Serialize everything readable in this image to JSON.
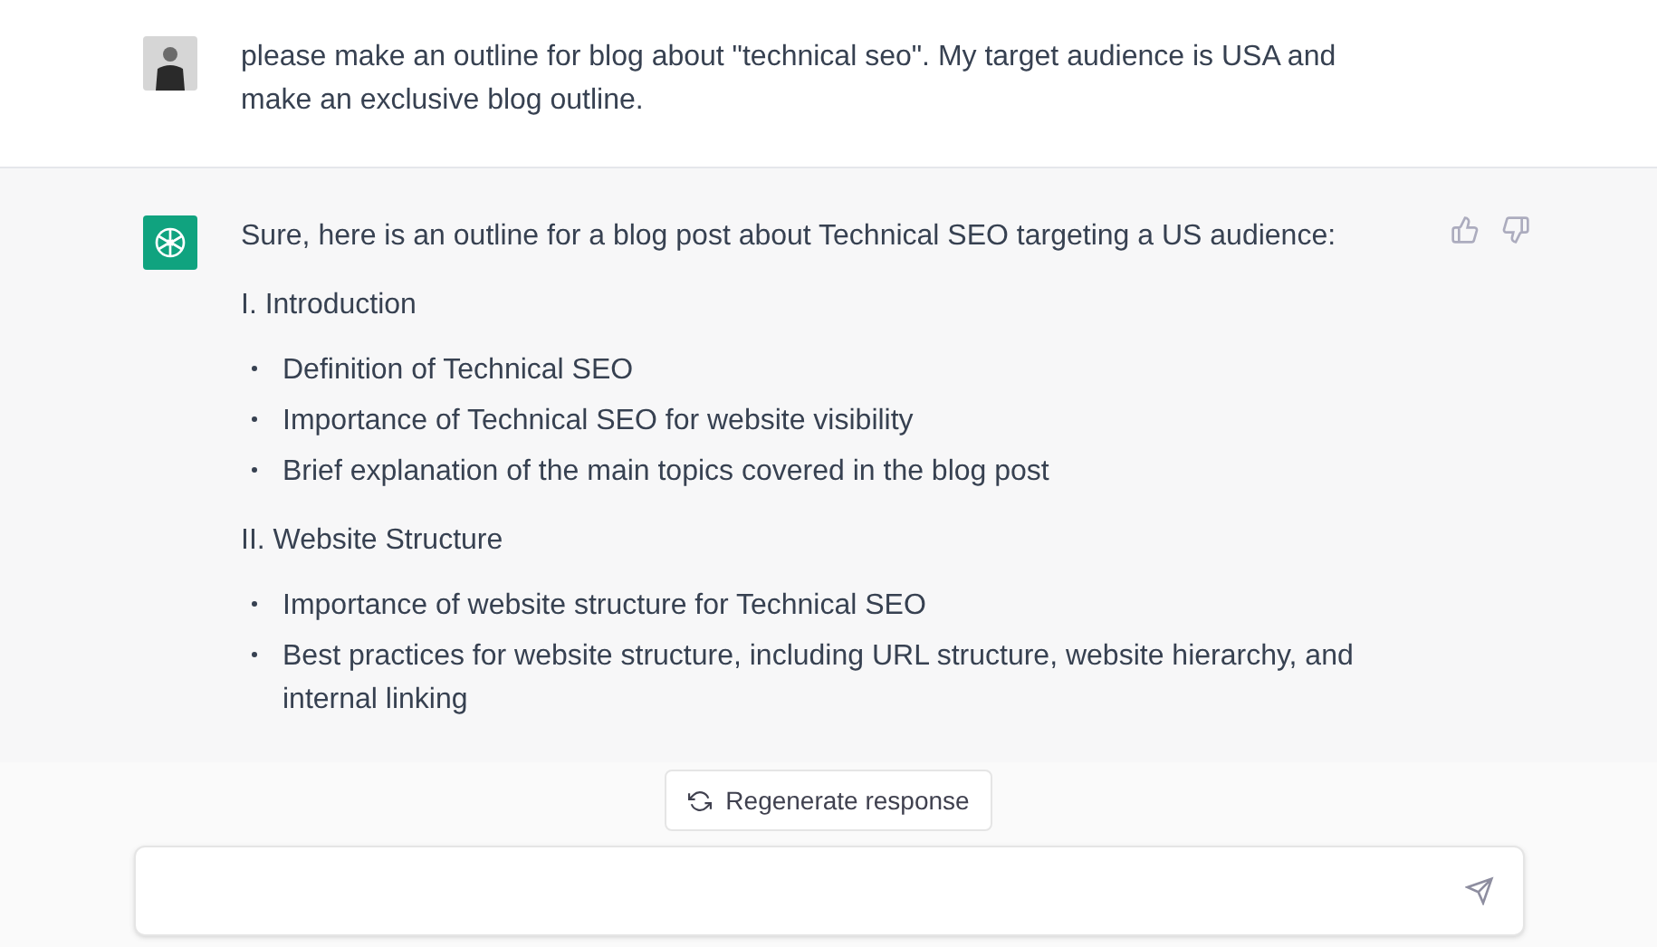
{
  "user_message": {
    "text": "please make an outline for blog about \"technical seo\". My target audience is USA and make an exclusive blog outline."
  },
  "assistant_message": {
    "intro": "Sure, here is an outline for a blog post about Technical SEO targeting a US audience:",
    "sections": [
      {
        "heading": "I. Introduction",
        "bullets": [
          "Definition of Technical SEO",
          "Importance of Technical SEO for website visibility",
          "Brief explanation of the main topics covered in the blog post"
        ]
      },
      {
        "heading": "II. Website Structure",
        "bullets": [
          "Importance of website structure for Technical SEO",
          "Best practices for website structure, including URL structure, website hierarchy, and internal linking"
        ]
      }
    ]
  },
  "regenerate_button": {
    "label": "Regenerate response"
  }
}
